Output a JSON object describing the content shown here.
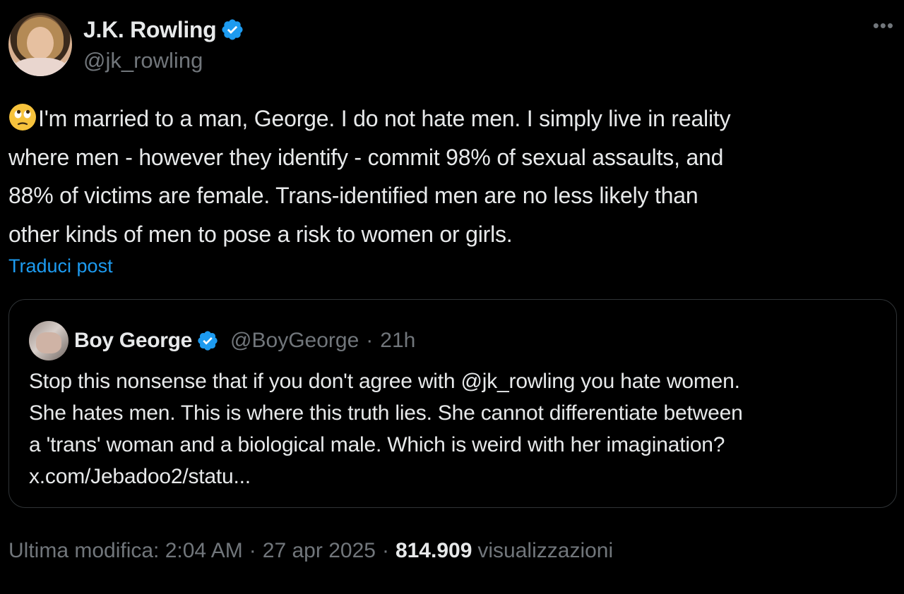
{
  "author": {
    "display_name": "J.K. Rowling",
    "handle": "@jk_rowling",
    "verified_icon": "verified-badge-icon"
  },
  "more_icon": "more-horizontal-icon",
  "body": {
    "emoji": "face-with-rolling-eyes",
    "lines": [
      "I'm married to a man, George. I do not hate men. I simply live in reality",
      "where men - however they identify - commit 98% of sexual assaults, and",
      "88% of victims are female. Trans-identified men are no less likely than",
      "other kinds of men to pose a risk to women or girls."
    ]
  },
  "translate_label": "Traduci post",
  "quote": {
    "display_name": "Boy George",
    "handle": "@BoyGeorge",
    "separator": "·",
    "time": "21h",
    "lines": [
      "Stop this nonsense that if you don't agree with @jk_rowling you hate women.",
      "She hates men. This is where this truth lies. She cannot differentiate between",
      "a 'trans' woman and a biological male. Which is weird with her imagination?",
      "x.com/Jebadoo2/statu..."
    ]
  },
  "footer": {
    "edited_label": "Ultima modifica: 2:04 AM",
    "separator": "·",
    "date": "27 apr 2025",
    "views_count": "814.909",
    "views_label": "visualizzazioni"
  },
  "colors": {
    "background": "#000000",
    "text": "#e7e9ea",
    "secondary": "#71767b",
    "accent": "#1d9bf0",
    "border": "#2f3336"
  }
}
